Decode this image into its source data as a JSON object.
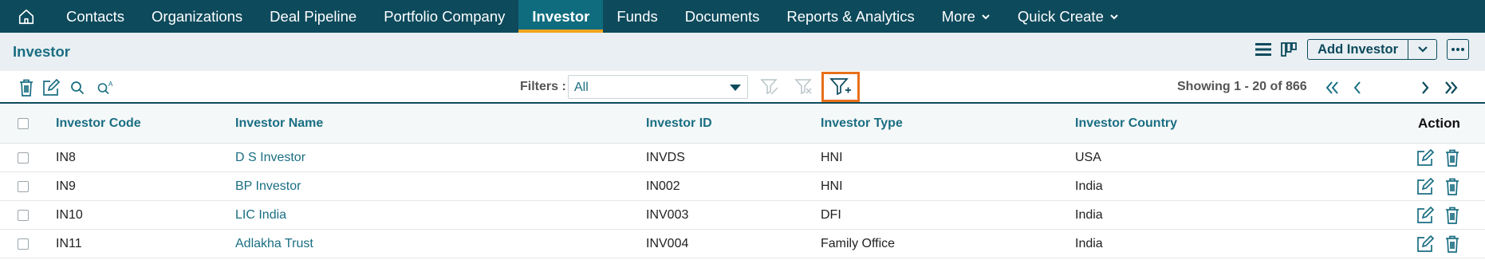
{
  "nav": {
    "items": [
      {
        "label": "Contacts",
        "active": false
      },
      {
        "label": "Organizations",
        "active": false
      },
      {
        "label": "Deal Pipeline",
        "active": false
      },
      {
        "label": "Portfolio Company",
        "active": false
      },
      {
        "label": "Investor",
        "active": true
      },
      {
        "label": "Funds",
        "active": false
      },
      {
        "label": "Documents",
        "active": false
      },
      {
        "label": "Reports & Analytics",
        "active": false
      }
    ],
    "more_label": "More",
    "quick_create_label": "Quick Create",
    "accent_color": "#f2a31c",
    "bg_color": "#0d4a5c"
  },
  "titlebar": {
    "title": "Investor",
    "add_button_label": "Add Investor"
  },
  "toolbar": {
    "filters_label": "Filters :",
    "filter_value": "All",
    "showing_text": "Showing 1 - 20 of 866",
    "highlight_color": "#e8701a"
  },
  "table": {
    "columns": [
      "Investor Code",
      "Investor Name",
      "Investor ID",
      "Investor Type",
      "Investor Country",
      "Action"
    ],
    "rows": [
      {
        "code": "IN8",
        "name": "D S Investor",
        "id": "INVDS",
        "type": "HNI",
        "country": "USA"
      },
      {
        "code": "IN9",
        "name": "BP Investor",
        "id": "IN002",
        "type": "HNI",
        "country": "India"
      },
      {
        "code": "IN10",
        "name": "LIC India",
        "id": "INV003",
        "type": "DFI",
        "country": "India"
      },
      {
        "code": "IN11",
        "name": "Adlakha Trust",
        "id": "INV004",
        "type": "Family Office",
        "country": "India"
      }
    ]
  }
}
